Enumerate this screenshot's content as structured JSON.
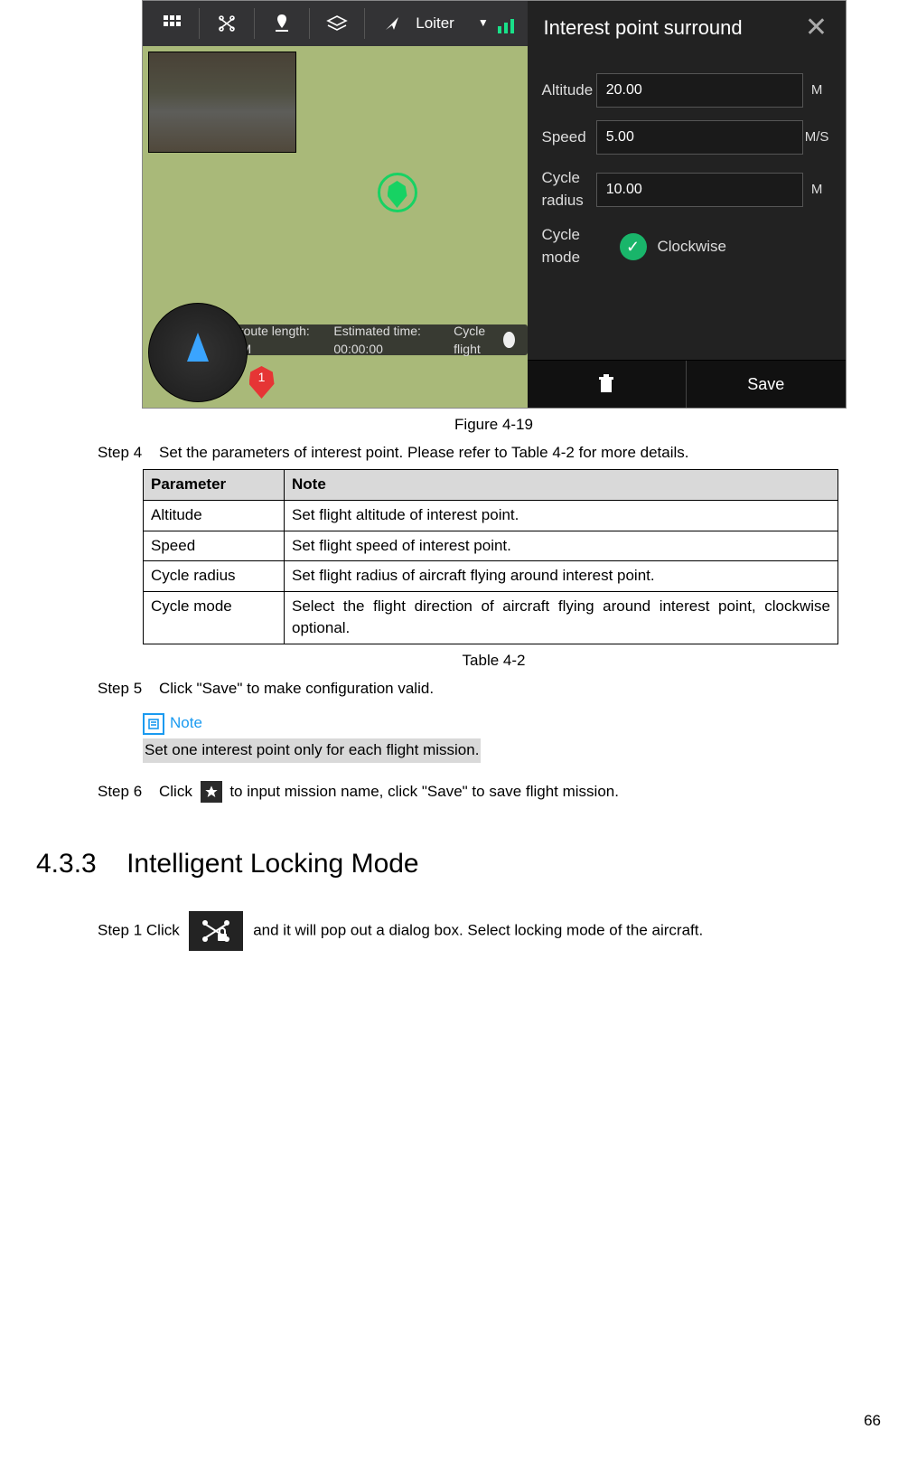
{
  "figure": {
    "caption": "Figure 4-19",
    "topnav": {
      "mode_label": "Loiter"
    },
    "panel": {
      "title": "Interest point surround",
      "rows": [
        {
          "label": "Altitude",
          "value": "20.00",
          "unit": "M"
        },
        {
          "label": "Speed",
          "value": "5.00",
          "unit": "M/S"
        },
        {
          "label": "Cycle radius",
          "value": "10.00",
          "unit": "M"
        }
      ],
      "cycle_mode_label": "Cycle mode",
      "cycle_mode_option": "Clockwise",
      "save_label": "Save"
    },
    "status": {
      "route": "Total route length: 62.75M",
      "time": "Estimated time: 00:00:00",
      "toggle_label": "Cycle flight"
    },
    "red_marker_number": "1"
  },
  "step4": {
    "tag": "Step 4",
    "text": "Set the parameters of interest point. Please refer to Table 4-2 for more details."
  },
  "table": {
    "caption": "Table 4-2",
    "headers": [
      "Parameter",
      "Note"
    ],
    "rows": [
      [
        "Altitude",
        "Set flight altitude of interest point."
      ],
      [
        "Speed",
        "Set flight speed of interest point."
      ],
      [
        "Cycle radius",
        "Set flight radius of aircraft flying around interest point."
      ],
      [
        "Cycle mode",
        "Select the flight direction of aircraft flying around interest point, clockwise optional."
      ]
    ]
  },
  "step5": {
    "tag": "Step 5",
    "text": "Click \"Save\" to make configuration valid."
  },
  "note": {
    "label": "Note",
    "text": "Set one interest point only for each flight mission."
  },
  "step6": {
    "tag": "Step 6",
    "pre": "Click",
    "post": "to input mission name, click \"Save\" to save flight mission."
  },
  "section": {
    "number": "4.3.3",
    "title": "Intelligent Locking Mode"
  },
  "step1": {
    "tag": "Step 1",
    "pre": "Click",
    "post": "and it will pop out a dialog box. Select locking mode of the aircraft."
  },
  "page_number": "66"
}
